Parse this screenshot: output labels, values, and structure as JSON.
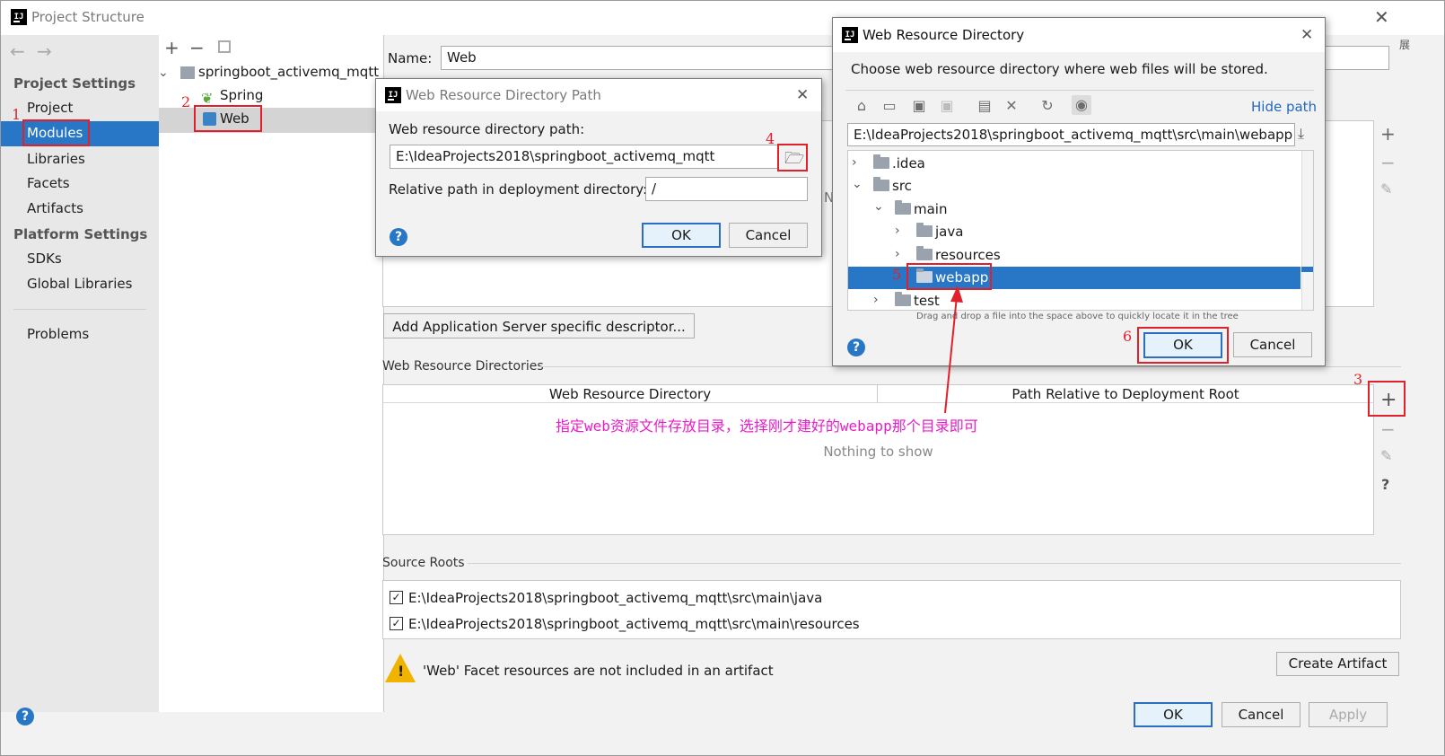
{
  "window": {
    "title": "Project Structure"
  },
  "sidebar": {
    "section1": "Project Settings",
    "items1": [
      "Project",
      "Modules",
      "Libraries",
      "Facets",
      "Artifacts"
    ],
    "section2": "Platform Settings",
    "items2": [
      "SDKs",
      "Global Libraries"
    ],
    "problems": "Problems",
    "selected": "Modules"
  },
  "tree": {
    "root": "springboot_activemq_mqtt",
    "children": [
      "Spring",
      "Web"
    ],
    "selected": "Web"
  },
  "main": {
    "name_label": "Name:",
    "name_value": "Web",
    "add_descriptor": "Add Application Server specific descriptor...",
    "web_resource_dirs_title": "Web Resource Directories",
    "col1": "Web Resource Directory",
    "col2": "Path Relative to Deployment Root",
    "nothing": "Nothing to show",
    "source_roots_title": "Source Roots",
    "source_roots": [
      "E:\\IdeaProjects2018\\springboot_activemq_mqtt\\src\\main\\java",
      "E:\\IdeaProjects2018\\springboot_activemq_mqtt\\src\\main\\resources"
    ],
    "warning": "'Web' Facet resources are not included in an artifact",
    "create_artifact": "Create Artifact",
    "partial_n": "N"
  },
  "footer": {
    "ok": "OK",
    "cancel": "Cancel",
    "apply": "Apply"
  },
  "path_dialog": {
    "title": "Web Resource Directory Path",
    "path_label": "Web resource directory path:",
    "path_value": "E:\\IdeaProjects2018\\springboot_activemq_mqtt",
    "relative_label": "Relative path in deployment directory:",
    "relative_value": "/",
    "ok": "OK",
    "cancel": "Cancel"
  },
  "chooser": {
    "title": "Web Resource Directory",
    "description": "Choose web resource directory where web files will be stored.",
    "hide_path": "Hide path",
    "path": "E:\\IdeaProjects2018\\springboot_activemq_mqtt\\src\\main\\webapp",
    "tree": [
      ".idea",
      "src",
      "main",
      "java",
      "resources",
      "webapp",
      "test"
    ],
    "selected": "webapp",
    "hint": "Drag and drop a file into the space above to quickly locate it in the tree",
    "ok": "OK",
    "cancel": "Cancel"
  },
  "annotations": {
    "steps": [
      "1",
      "2",
      "3",
      "4",
      "5",
      "6"
    ],
    "note": "指定web资源文件存放目录，选择刚才建好的webapp那个目录即可",
    "accent": "#e0212c",
    "note_color": "#e81cc8"
  },
  "colors": {
    "selection": "#2877c6",
    "link": "#2268c0"
  }
}
